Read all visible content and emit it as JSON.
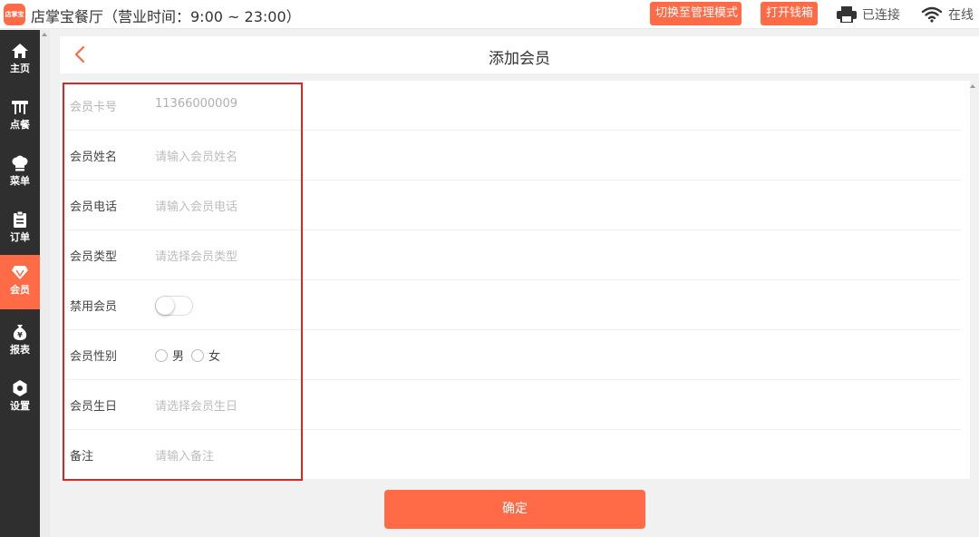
{
  "app": {
    "logo_text": "店掌宝",
    "title": "店掌宝餐厅（营业时间：9:00 ~ 23:00）"
  },
  "topbar": {
    "manage_mode_label": "切换至管理模式",
    "open_cashbox_label": "打开钱箱",
    "printer_status": "已连接",
    "network_status": "在线"
  },
  "sidebar": {
    "items": [
      {
        "label": "主页",
        "icon": "home-icon",
        "active": false
      },
      {
        "label": "点餐",
        "icon": "table-icon",
        "active": false
      },
      {
        "label": "菜单",
        "icon": "chef-hat-icon",
        "active": false
      },
      {
        "label": "订单",
        "icon": "clipboard-icon",
        "active": false
      },
      {
        "label": "会员",
        "icon": "diamond-icon",
        "active": true
      },
      {
        "label": "报表",
        "icon": "money-bag-icon",
        "active": false
      },
      {
        "label": "设置",
        "icon": "gear-icon",
        "active": false
      }
    ]
  },
  "header": {
    "title": "添加会员"
  },
  "form": {
    "card_number": {
      "label": "会员卡号",
      "value": "11366000009"
    },
    "name": {
      "label": "会员姓名",
      "placeholder": "请输入会员姓名"
    },
    "phone": {
      "label": "会员电话",
      "placeholder": "请输入会员电话"
    },
    "type": {
      "label": "会员类型",
      "placeholder": "请选择会员类型"
    },
    "disable": {
      "label": "禁用会员",
      "on": false
    },
    "gender": {
      "label": "会员性别",
      "options": [
        "男",
        "女"
      ]
    },
    "birthday": {
      "label": "会员生日",
      "placeholder": "请选择会员生日"
    },
    "note": {
      "label": "备注",
      "placeholder": "请输入备注"
    }
  },
  "confirm_label": "确定",
  "colors": {
    "accent": "#ff6b47",
    "sidebar_bg": "#2f2f2f",
    "highlight_border": "#e02424"
  }
}
